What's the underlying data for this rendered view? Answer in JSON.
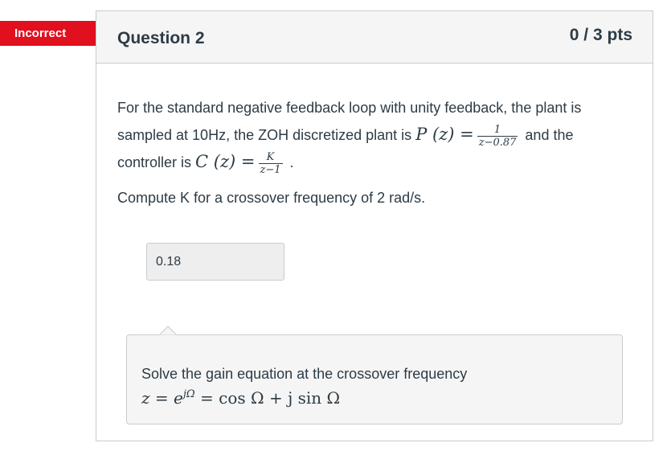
{
  "status": {
    "label": "Incorrect",
    "color": "#e0101e"
  },
  "question": {
    "title": "Question 2",
    "points": "0 / 3 pts",
    "text": {
      "line1": "For the standard negative feedback loop with unity feedback, the plant is",
      "line2_pre": "sampled at 10Hz, the ZOH discretized plant is",
      "plant_lhs": "P (z) =",
      "plant_num": "1",
      "plant_den": "z−0.87",
      "line2_post": "and the",
      "line3_pre": "controller is",
      "ctrl_lhs": "C (z) =",
      "ctrl_num": "K",
      "ctrl_den": "z−1",
      "line3_post": "."
    },
    "prompt": "Compute K for a crossover frequency of 2 rad/s."
  },
  "answer": {
    "value": "0.18"
  },
  "feedback": {
    "line1": "Solve the gain equation at the crossover frequency",
    "z_lhs": "z = e",
    "z_exp": "jΩ",
    "z_rhs": " = cos Ω + j sin Ω"
  }
}
